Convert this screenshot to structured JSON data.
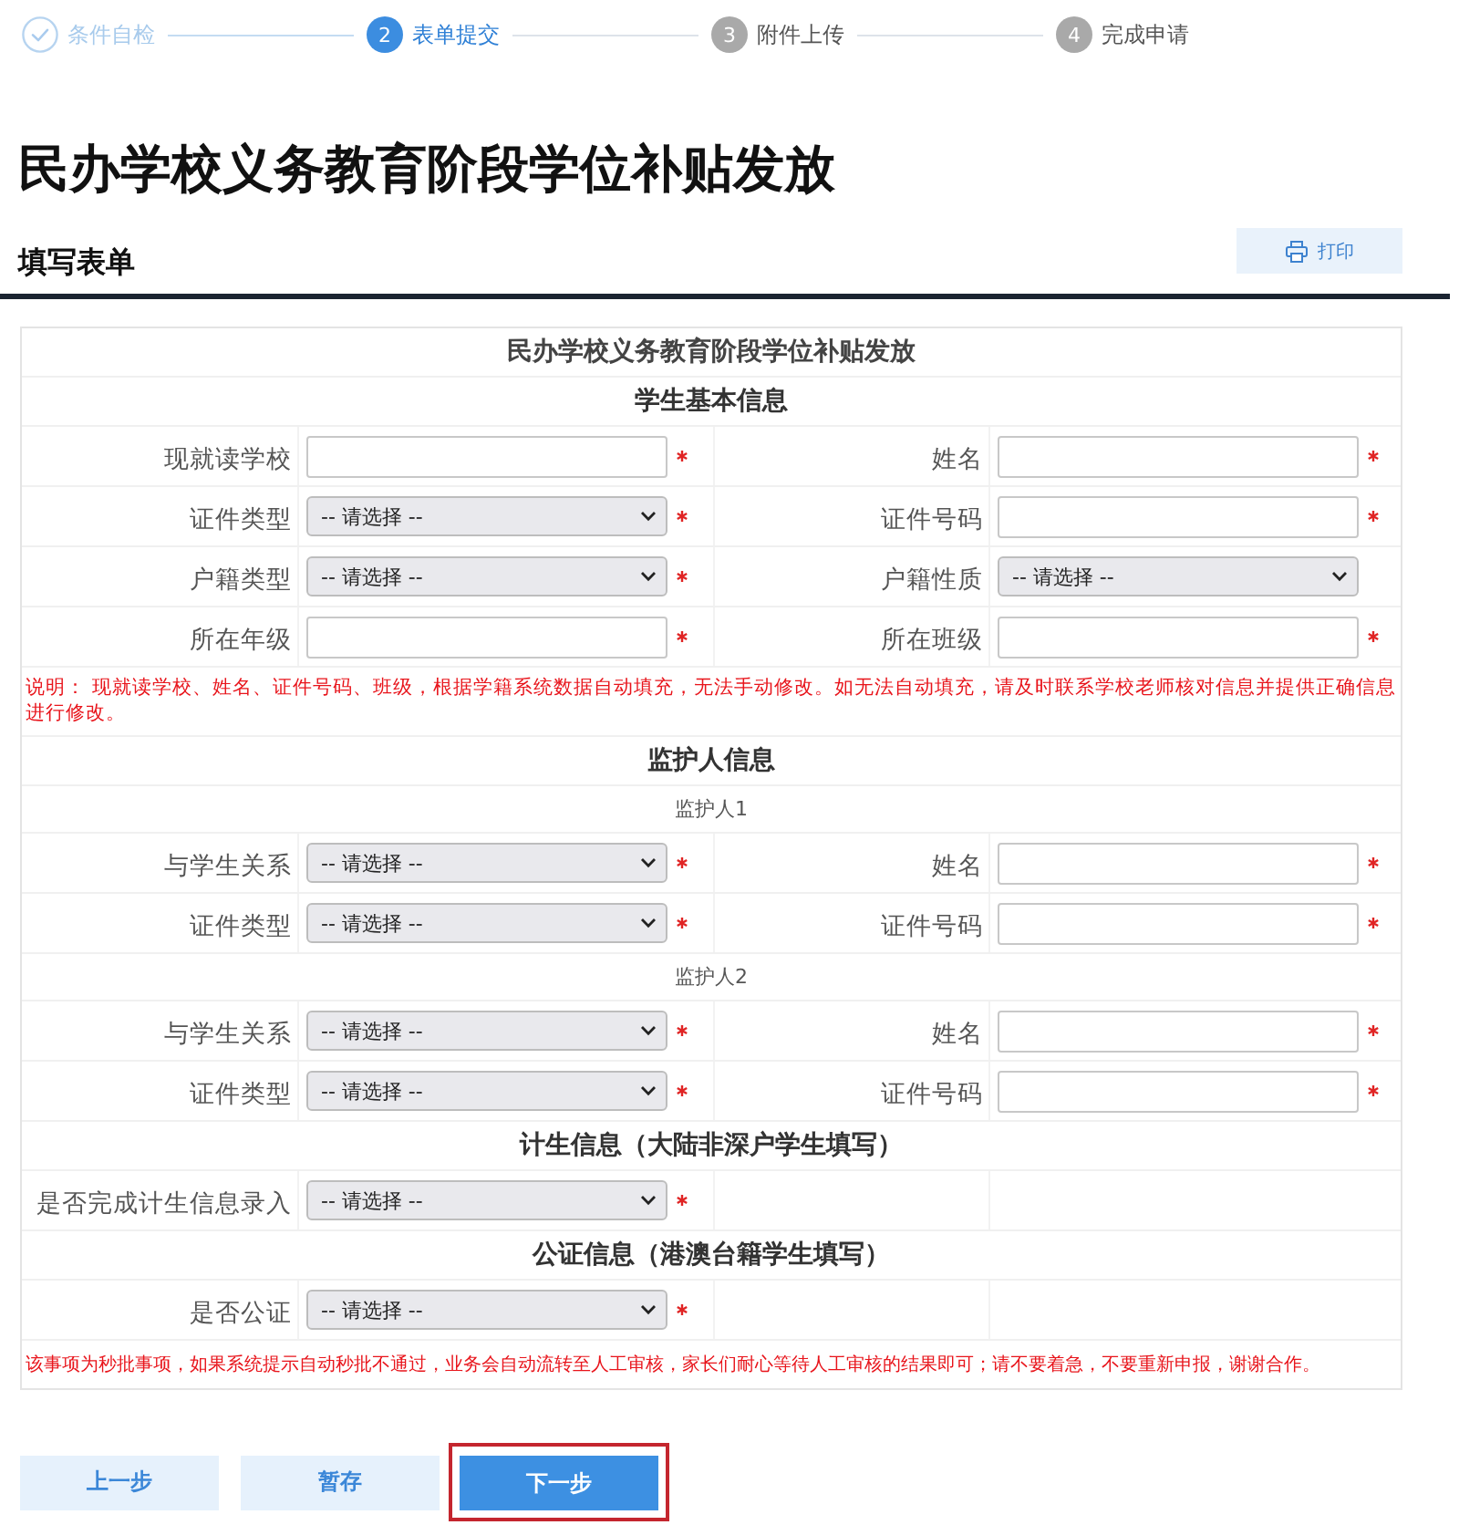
{
  "steps": [
    {
      "kind": "done",
      "label": "条件自检"
    },
    {
      "kind": "current",
      "number": "2",
      "label": "表单提交"
    },
    {
      "kind": "upcoming",
      "number": "3",
      "label": "附件上传"
    },
    {
      "kind": "upcoming",
      "number": "4",
      "label": "完成申请"
    }
  ],
  "page_title": "民办学校义务教育阶段学位补贴发放",
  "form_header": {
    "title": "填写表单",
    "print_button": "打印"
  },
  "form": {
    "title": "民办学校义务教育阶段学位补贴发放",
    "rows": [
      {
        "kind": "heading",
        "text": "学生基本信息"
      },
      {
        "kind": "fields",
        "cells": [
          {
            "label": "现就读学校",
            "kind": "input",
            "required": true
          },
          {
            "label": "姓名",
            "kind": "input",
            "required": true
          }
        ]
      },
      {
        "kind": "fields",
        "cells": [
          {
            "label": "证件类型",
            "kind": "select",
            "value": "-- 请选择 --",
            "required": true
          },
          {
            "label": "证件号码",
            "kind": "input",
            "required": true
          }
        ]
      },
      {
        "kind": "fields",
        "cells": [
          {
            "label": "户籍类型",
            "kind": "select",
            "value": "-- 请选择 --",
            "required": true
          },
          {
            "label": "户籍性质",
            "kind": "select",
            "value": "-- 请选择 --",
            "required": false
          }
        ]
      },
      {
        "kind": "fields",
        "cells": [
          {
            "label": "所在年级",
            "kind": "input",
            "required": true
          },
          {
            "label": "所在班级",
            "kind": "input",
            "required": true
          }
        ]
      },
      {
        "kind": "note",
        "text": "说明： 现就读学校、姓名、证件号码、班级，根据学籍系统数据自动填充，无法手动修改。如无法自动填充，请及时联系学校老师核对信息并提供正确信息进行修改。"
      },
      {
        "kind": "heading",
        "text": "监护人信息"
      },
      {
        "kind": "subheading",
        "text": "监护人1"
      },
      {
        "kind": "fields",
        "cells": [
          {
            "label": "与学生关系",
            "kind": "select",
            "value": "-- 请选择 --",
            "required": true
          },
          {
            "label": "姓名",
            "kind": "input",
            "required": true
          }
        ]
      },
      {
        "kind": "fields",
        "cells": [
          {
            "label": "证件类型",
            "kind": "select",
            "value": "-- 请选择 --",
            "required": true
          },
          {
            "label": "证件号码",
            "kind": "input",
            "required": true
          }
        ]
      },
      {
        "kind": "subheading",
        "text": "监护人2"
      },
      {
        "kind": "fields",
        "cells": [
          {
            "label": "与学生关系",
            "kind": "select",
            "value": "-- 请选择 --",
            "required": true
          },
          {
            "label": "姓名",
            "kind": "input",
            "required": true
          }
        ]
      },
      {
        "kind": "fields",
        "cells": [
          {
            "label": "证件类型",
            "kind": "select",
            "value": "-- 请选择 --",
            "required": true
          },
          {
            "label": "证件号码",
            "kind": "input",
            "required": true
          }
        ]
      },
      {
        "kind": "heading",
        "text": "计生信息（大陆非深户学生填写）"
      },
      {
        "kind": "fields",
        "cells": [
          {
            "label": "是否完成计生信息录入",
            "kind": "select",
            "value": "-- 请选择 --",
            "required": true
          }
        ]
      },
      {
        "kind": "heading",
        "text": "公证信息（港澳台籍学生填写）"
      },
      {
        "kind": "fields",
        "cells": [
          {
            "label": "是否公证",
            "kind": "select",
            "value": "-- 请选择 --",
            "required": true
          }
        ]
      },
      {
        "kind": "notice",
        "text": "该事项为秒批事项，如果系统提示自动秒批不通过，业务会自动流转至人工审核，家长们耐心等待人工审核的结果即可；请不要着急，不要重新申报，谢谢合作。"
      }
    ]
  },
  "buttons": [
    {
      "label": "上一步",
      "kind": "secondary",
      "highlighted": false
    },
    {
      "label": "暂存",
      "kind": "secondary",
      "highlighted": false
    },
    {
      "label": "下一步",
      "kind": "primary",
      "highlighted": true
    }
  ]
}
